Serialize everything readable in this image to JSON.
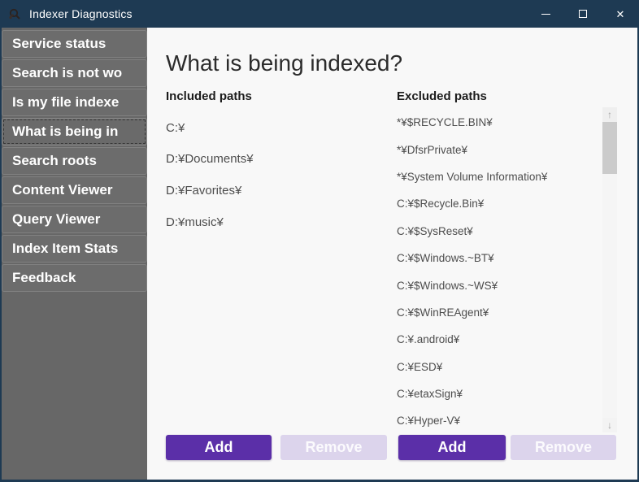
{
  "window": {
    "title": "Indexer Diagnostics",
    "controls": {
      "close_glyph": "✕"
    }
  },
  "sidebar": {
    "selected_index": 3,
    "items": [
      "Service status",
      "Search is not wo",
      "Is my file indexe",
      "What is being in",
      "Search roots",
      "Content Viewer",
      "Query Viewer",
      "Index Item Stats",
      "Feedback"
    ]
  },
  "main": {
    "heading": "What is being indexed?",
    "included": {
      "label": "Included paths",
      "paths": [
        "C:¥",
        "D:¥Documents¥",
        "D:¥Favorites¥",
        "D:¥music¥"
      ],
      "add_label": "Add",
      "remove_label": "Remove"
    },
    "excluded": {
      "label": "Excluded paths",
      "paths": [
        "*¥$RECYCLE.BIN¥",
        "*¥DfsrPrivate¥",
        "*¥System Volume Information¥",
        "C:¥$Recycle.Bin¥",
        "C:¥$SysReset¥",
        "C:¥$Windows.~BT¥",
        "C:¥$Windows.~WS¥",
        "C:¥$WinREAgent¥",
        "C:¥.android¥",
        "C:¥ESD¥",
        "C:¥etaxSign¥",
        "C:¥Hyper-V¥"
      ],
      "add_label": "Add",
      "remove_label": "Remove"
    },
    "scrollbar": {
      "up_glyph": "↑",
      "down_glyph": "↓"
    }
  },
  "colors": {
    "titlebar": "#1e3a53",
    "sidebar": "#676767",
    "accent": "#5b2fa8",
    "disabled_button": "#dcd4ec",
    "content_bg": "#f8f8f8"
  }
}
